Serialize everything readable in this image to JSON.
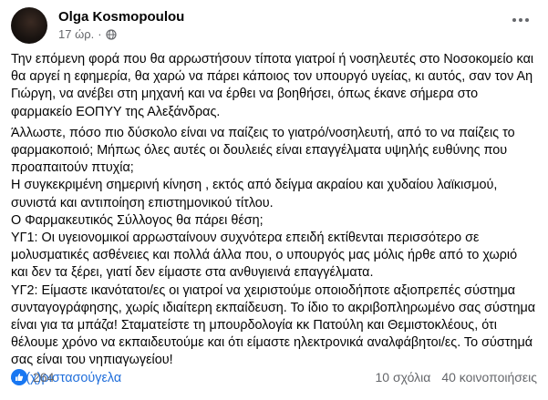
{
  "post": {
    "author": "Olga Kosmopoulou",
    "time": "17 ώρ.",
    "time_separator": "·",
    "paragraphs": [
      "Την επόμενη φορά που θα αρρωστήσουν τίποτα γιατροί ή νοσηλευτές στο Νοσοκομείο και θα αργεί η εφημερία, θα χαρώ να πάρει κάποιος τον υπουργό υγείας, κι αυτός, σαν τον Αη Γιώργη, να ανέβει στη μηχανή και να έρθει να βοηθήσει, όπως έκανε σήμερα στο φαρμακείο ΕΟΠΥΥ της Αλεξάνδρας.",
      "Άλλωστε, πόσο πιο δύσκολο είναι να παίζεις το γιατρό/νοσηλευτή, από το να παίζεις το φαρμακοποιό; Μήπως όλες αυτές οι δουλειές είναι επαγγέλματα υψηλής ευθύνης που προαπαιτούν πτυχία;",
      "Η συγκεκριμένη σημερινή κίνηση , εκτός από δείγμα ακραίου και χυδαίου λαϊκισμού, συνιστά και αντιποίηση επιστημονικού τίτλου.",
      "Ο Φαρμακευτικός Σύλλογος θα πάρει θέση;",
      "ΥΓ1: Οι υγειονομικοί αρρωσταίνουν συχνότερα επειδή εκτίθενται περισσότερο σε μολυσματικές ασθένειες και πολλά άλλα που, ο υπουργός μας μόλις ήρθε από το χωριό και δεν τα ξέρει, γιατί δεν είμαστε στα ανθυγιεινά επαγγέλματα.",
      "ΥΓ2: Είμαστε ικανότατοι/ες οι γιατροί να χειριστούμε οποιοδήποτε αξιοπρεπές σύστημα συνταγογράφησης, χωρίς ιδιαίτερη εκπαίδευση. Το ίδιο το ακριβοπληρωμένο σας σύστημα είναι για τα μπάζα! Σταματείστε τη μπουρδολογία κκ Πατούλη και Θεμιστοκλέους, ότι θέλουμε χρόνο να εκπαιδευτούμε και ότι είμαστε ηλεκτρονικά αναλφάβητοι/ες. Το σύστημά σας είναι του νηπιαγωγείου!"
    ],
    "hashtag": "#ά(χ)ριστασούγελα"
  },
  "footer": {
    "reactions": "264",
    "comments": "10 σχόλια",
    "shares": "40 κοινοποιήσεις"
  },
  "colors": {
    "hashtag": "#216fdb",
    "like": "#1877f2",
    "secondary_text": "#65676b"
  },
  "icons": {
    "privacy": "globe-icon",
    "menu": "more-options-icon",
    "reaction": "like-icon"
  }
}
